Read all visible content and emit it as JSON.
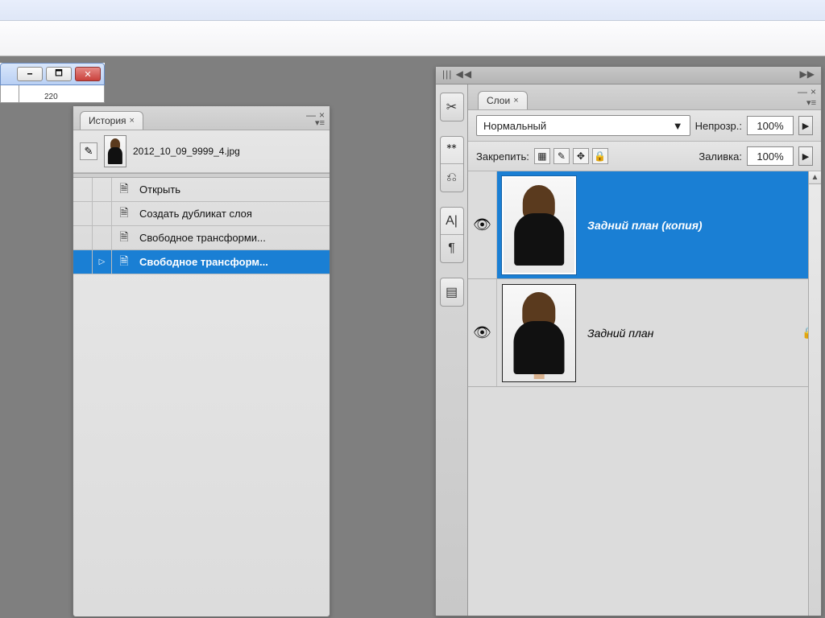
{
  "ruler": {
    "tick": "220"
  },
  "history": {
    "tab": "История",
    "filename": "2012_10_09_9999_4.jpg",
    "items": [
      {
        "label": "Открыть",
        "selected": false
      },
      {
        "label": "Создать дубликат слоя",
        "selected": false
      },
      {
        "label": "Свободное трансформи...",
        "selected": false
      },
      {
        "label": "Свободное трансформ...",
        "selected": true
      }
    ]
  },
  "layers": {
    "tab": "Слои",
    "blend_mode": "Нормальный",
    "opacity_label": "Непрозр.:",
    "opacity": "100%",
    "lock_label": "Закрепить:",
    "fill_label": "Заливка:",
    "fill": "100%",
    "items": [
      {
        "name": "Задний план (копия)",
        "selected": true,
        "visible": true,
        "locked": false,
        "thumb": "head"
      },
      {
        "name": "Задний план",
        "selected": false,
        "visible": true,
        "locked": true,
        "thumb": "full"
      }
    ]
  }
}
